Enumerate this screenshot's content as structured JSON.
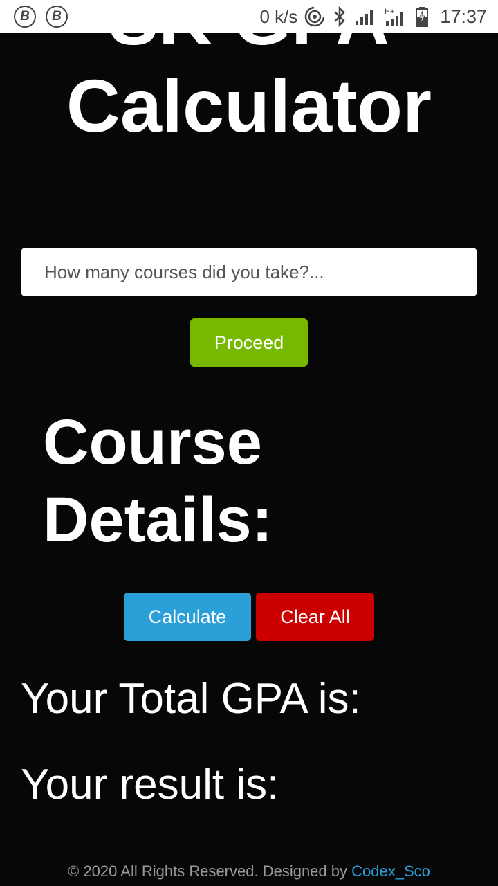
{
  "status_bar": {
    "left_icons": [
      "B",
      "B"
    ],
    "speed": "0 k/s",
    "network": "H+",
    "time": "17:37"
  },
  "title": "SK GPA Calculator",
  "courses_input": {
    "placeholder": "How many courses did you take?...",
    "value": ""
  },
  "buttons": {
    "proceed": "Proceed",
    "calculate": "Calculate",
    "clear_all": "Clear All"
  },
  "details_heading": "Course Details:",
  "results": {
    "gpa_label": "Your Total GPA is:",
    "result_label": "Your result is:"
  },
  "footer": {
    "text": "© 2020 All Rights Reserved. Designed by",
    "link": "Codex_Sco"
  },
  "colors": {
    "background": "#070707",
    "proceed": "#76b900",
    "calculate": "#2a9fd8",
    "clear": "#cc0000",
    "link": "#2a9fd8"
  }
}
